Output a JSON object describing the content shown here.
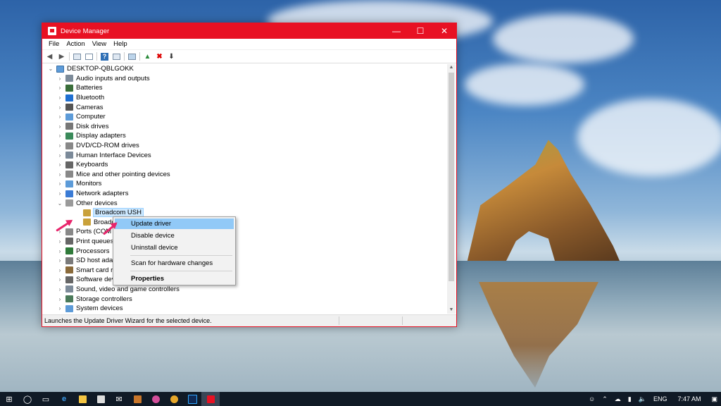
{
  "window": {
    "title": "Device Manager"
  },
  "menubar": [
    "File",
    "Action",
    "View",
    "Help"
  ],
  "tree": {
    "root": "DESKTOP-QBLGOKK",
    "categories": [
      {
        "label": "Audio inputs and outputs",
        "icon": "speaker-icon"
      },
      {
        "label": "Batteries",
        "icon": "battery-icon"
      },
      {
        "label": "Bluetooth",
        "icon": "bluetooth-icon"
      },
      {
        "label": "Cameras",
        "icon": "camera-icon"
      },
      {
        "label": "Computer",
        "icon": "computer-icon"
      },
      {
        "label": "Disk drives",
        "icon": "disk-drive-icon"
      },
      {
        "label": "Display adapters",
        "icon": "display-adapter-icon"
      },
      {
        "label": "DVD/CD-ROM drives",
        "icon": "dvd-drive-icon"
      },
      {
        "label": "Human Interface Devices",
        "icon": "hid-icon"
      },
      {
        "label": "Keyboards",
        "icon": "keyboard-icon"
      },
      {
        "label": "Mice and other pointing devices",
        "icon": "mouse-icon"
      },
      {
        "label": "Monitors",
        "icon": "monitor-icon"
      },
      {
        "label": "Network adapters",
        "icon": "network-adapter-icon"
      },
      {
        "label": "Other devices",
        "icon": "unknown-device-icon"
      }
    ],
    "other_devices": [
      "Broadcom USH",
      "Broadcom"
    ],
    "after": [
      {
        "label": "Ports (COM &",
        "icon": "port-icon"
      },
      {
        "label": "Print queues",
        "icon": "printer-icon"
      },
      {
        "label": "Processors",
        "icon": "processor-icon"
      },
      {
        "label": "SD host adap",
        "icon": "sd-host-icon"
      },
      {
        "label": "Smart card re",
        "icon": "smart-card-icon"
      },
      {
        "label": "Software dev",
        "icon": "software-device-icon"
      },
      {
        "label": "Sound, video and game controllers",
        "icon": "sound-icon"
      },
      {
        "label": "Storage controllers",
        "icon": "storage-icon"
      },
      {
        "label": "System devices",
        "icon": "system-device-icon"
      }
    ]
  },
  "context_menu": {
    "update": "Update driver",
    "disable": "Disable device",
    "uninstall": "Uninstall device",
    "scan": "Scan for hardware changes",
    "properties": "Properties"
  },
  "status": "Launches the Update Driver Wizard for the selected device.",
  "taskbar": {
    "language": "ENG",
    "time": "7:47 AM"
  },
  "colors": {
    "accent": "#e81123",
    "selection": "#cce8ff",
    "menu_highlight": "#91c9f7",
    "annotation_arrow": "#e8246b"
  }
}
